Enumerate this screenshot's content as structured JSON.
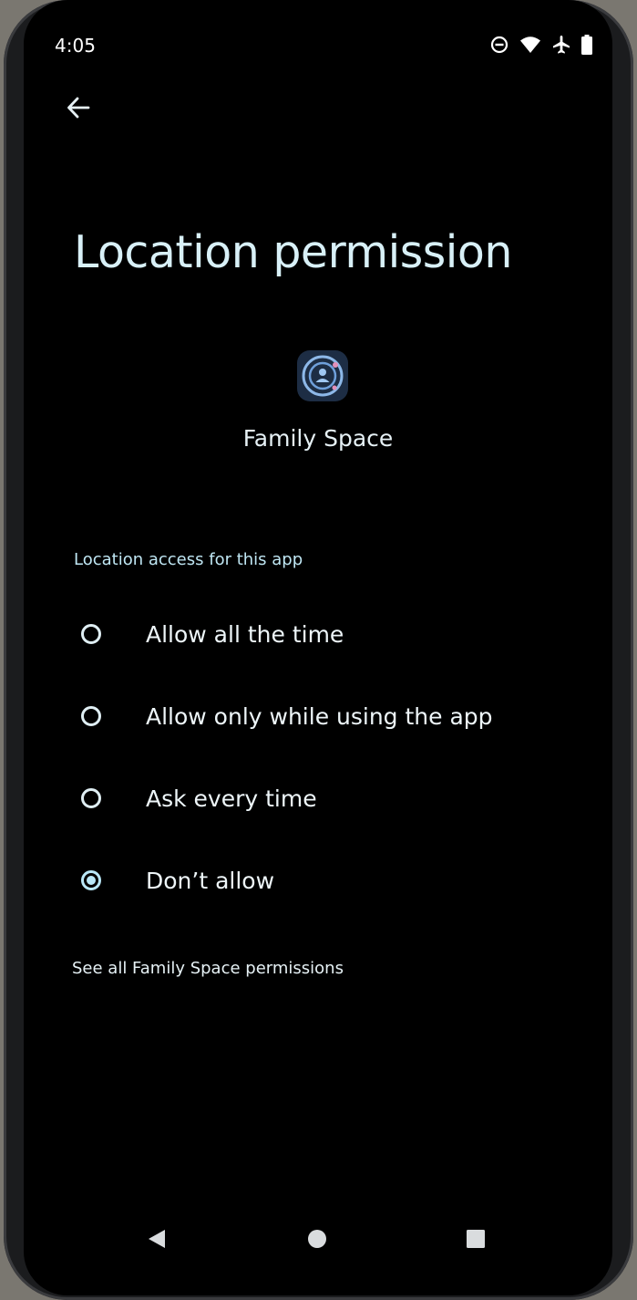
{
  "status_bar": {
    "time": "4:05",
    "icons": [
      "do-not-disturb-icon",
      "wifi-icon",
      "airplane-mode-icon",
      "battery-icon"
    ]
  },
  "header": {
    "back_icon": "arrow-left-icon",
    "title": "Location permission"
  },
  "app": {
    "icon": "family-space-app-icon",
    "name": "Family Space"
  },
  "permission": {
    "section_label": "Location access for this app",
    "options": [
      {
        "label": "Allow all the time",
        "selected": false
      },
      {
        "label": "Allow only while using the app",
        "selected": false
      },
      {
        "label": "Ask every time",
        "selected": false
      },
      {
        "label": "Don’t allow",
        "selected": true
      }
    ],
    "see_all_link": "See all Family Space permissions"
  },
  "navigation": {
    "icons": [
      "nav-back-icon",
      "nav-home-icon",
      "nav-recents-icon"
    ]
  },
  "colors": {
    "background": "#000000",
    "title_text": "#d8f0f7",
    "accent": "#b9e7f7"
  }
}
